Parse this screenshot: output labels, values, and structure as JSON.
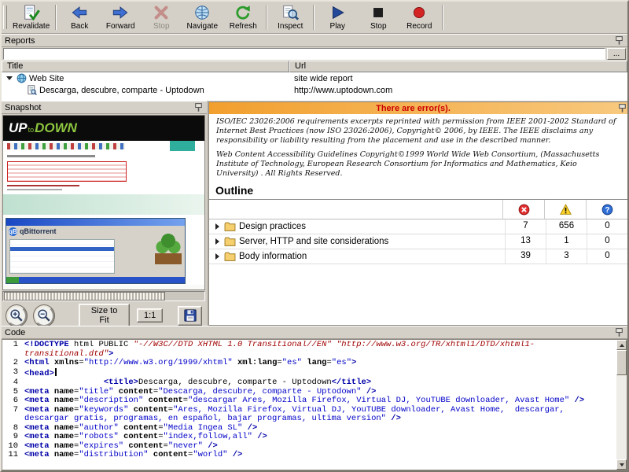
{
  "colors": {
    "window_bg": "#d4d0c8",
    "banner_orange": "#f29f2e",
    "status_red": "#cc0000",
    "warning_yellow": "#ffd22e",
    "question_blue": "#2f6fd6"
  },
  "toolbar": {
    "items": [
      {
        "kind": "button",
        "label": "Revalidate",
        "icon": "revalidate",
        "enabled": true
      },
      {
        "kind": "sep"
      },
      {
        "kind": "button",
        "label": "Back",
        "icon": "back",
        "enabled": true
      },
      {
        "kind": "button",
        "label": "Forward",
        "icon": "forward",
        "enabled": true
      },
      {
        "kind": "button",
        "label": "Stop",
        "icon": "stop-x",
        "enabled": false
      },
      {
        "kind": "button",
        "label": "Navigate",
        "icon": "navigate",
        "enabled": true
      },
      {
        "kind": "button",
        "label": "Refresh",
        "icon": "refresh",
        "enabled": true
      },
      {
        "kind": "sep"
      },
      {
        "kind": "button",
        "label": "Inspect",
        "icon": "inspect",
        "enabled": true
      },
      {
        "kind": "sep"
      },
      {
        "kind": "button",
        "label": "Play",
        "icon": "play",
        "enabled": true
      },
      {
        "kind": "button",
        "label": "Stop",
        "icon": "stop-square",
        "enabled": true
      },
      {
        "kind": "button",
        "label": "Record",
        "icon": "record",
        "enabled": true
      },
      {
        "kind": "sep"
      }
    ]
  },
  "reports": {
    "panel_title": "Reports",
    "browse_button_label": "...",
    "filter_value": "",
    "columns": [
      "Title",
      "Url"
    ],
    "rows": [
      {
        "title": "Web Site",
        "url": "site wide report",
        "level": 0,
        "icon": "site",
        "expanded": true
      },
      {
        "title": "Descarga, descubre, comparte - Uptodown",
        "url": "http://www.uptodown.com",
        "level": 1,
        "icon": "page",
        "expanded": false
      }
    ]
  },
  "snapshot": {
    "panel_title": "Snapshot",
    "logo": {
      "up": "UP",
      "to": "to",
      "down": "DOWN"
    },
    "app_logo": "qB",
    "app_window_title": "qBittorrent",
    "controls": {
      "size_to_fit": "Size to Fit",
      "actual_size": "1:1"
    }
  },
  "results": {
    "status_banner": "There are error(s).",
    "license_paragraphs": [
      "ISO/IEC 23026:2006 requirements excerpts reprinted with permission from IEEE 2001-2002 Standard of Internet Best Practices (now ISO 23026:2006), Copyright© 2006, by IEEE. The IEEE disclaims any responsibility or liability resulting from the placement and use in the described manner.",
      "Web Content Accessibility Guidelines Copyright©1999 World Wide Web Consortium, (Massachusetts Institute of Technology, European Research Consortium for Informatics and Mathematics, Keio University) . All Rights Reserved."
    ],
    "outline_title": "Outline",
    "count_columns": [
      {
        "name": "errors",
        "icon": "error"
      },
      {
        "name": "warnings",
        "icon": "warning"
      },
      {
        "name": "questions",
        "icon": "question"
      }
    ],
    "rows": [
      {
        "label": "Design practices",
        "errors": 7,
        "warnings": 656,
        "questions": 0
      },
      {
        "label": "Server, HTTP and site considerations",
        "errors": 13,
        "warnings": 1,
        "questions": 0
      },
      {
        "label": "Body information",
        "errors": 39,
        "warnings": 3,
        "questions": 0
      }
    ]
  },
  "code": {
    "panel_title": "Code",
    "lines": [
      {
        "n": "1",
        "text": "<!DOCTYPE html PUBLIC \"-//W3C//DTD XHTML 1.0 Transitional//EN\" \"http://www.w3.org/TR/xhtml1/DTD/xhtml1-transitional.dtd\">"
      },
      {
        "n": "2",
        "text": "<html xmlns=\"http://www.w3.org/1999/xhtml\" xml:lang=\"es\" lang=\"es\">"
      },
      {
        "n": "3",
        "text": "<head>",
        "caret": true
      },
      {
        "n": "4",
        "text": "                <title>Descarga, descubre, comparte - Uptodown</title>"
      },
      {
        "n": "5",
        "text": "<meta name=\"title\" content=\"Descarga, descubre, comparte - Uptodown\" />"
      },
      {
        "n": "6",
        "text": "<meta name=\"description\" content=\"descargar Ares, Mozilla Firefox, Virtual DJ, YouTUBE downloader, Avast Home\" />"
      },
      {
        "n": "7",
        "text": "<meta name=\"keywords\" content=\"Ares, Mozilla Firefox, Virtual DJ, YouTUBE downloader, Avast Home,  descargar, descargar gratis, programas, en español, bajar programas, ultima version\" />"
      },
      {
        "n": "8",
        "text": "<meta name=\"author\" content=\"Media Ingea SL\" />"
      },
      {
        "n": "9",
        "text": "<meta name=\"robots\" content=\"index,follow,all\" />"
      },
      {
        "n": "10",
        "text": "<meta name=\"expires\" content=\"never\" />"
      },
      {
        "n": "11",
        "text": "<meta name=\"distribution\" content=\"world\" />"
      }
    ]
  }
}
